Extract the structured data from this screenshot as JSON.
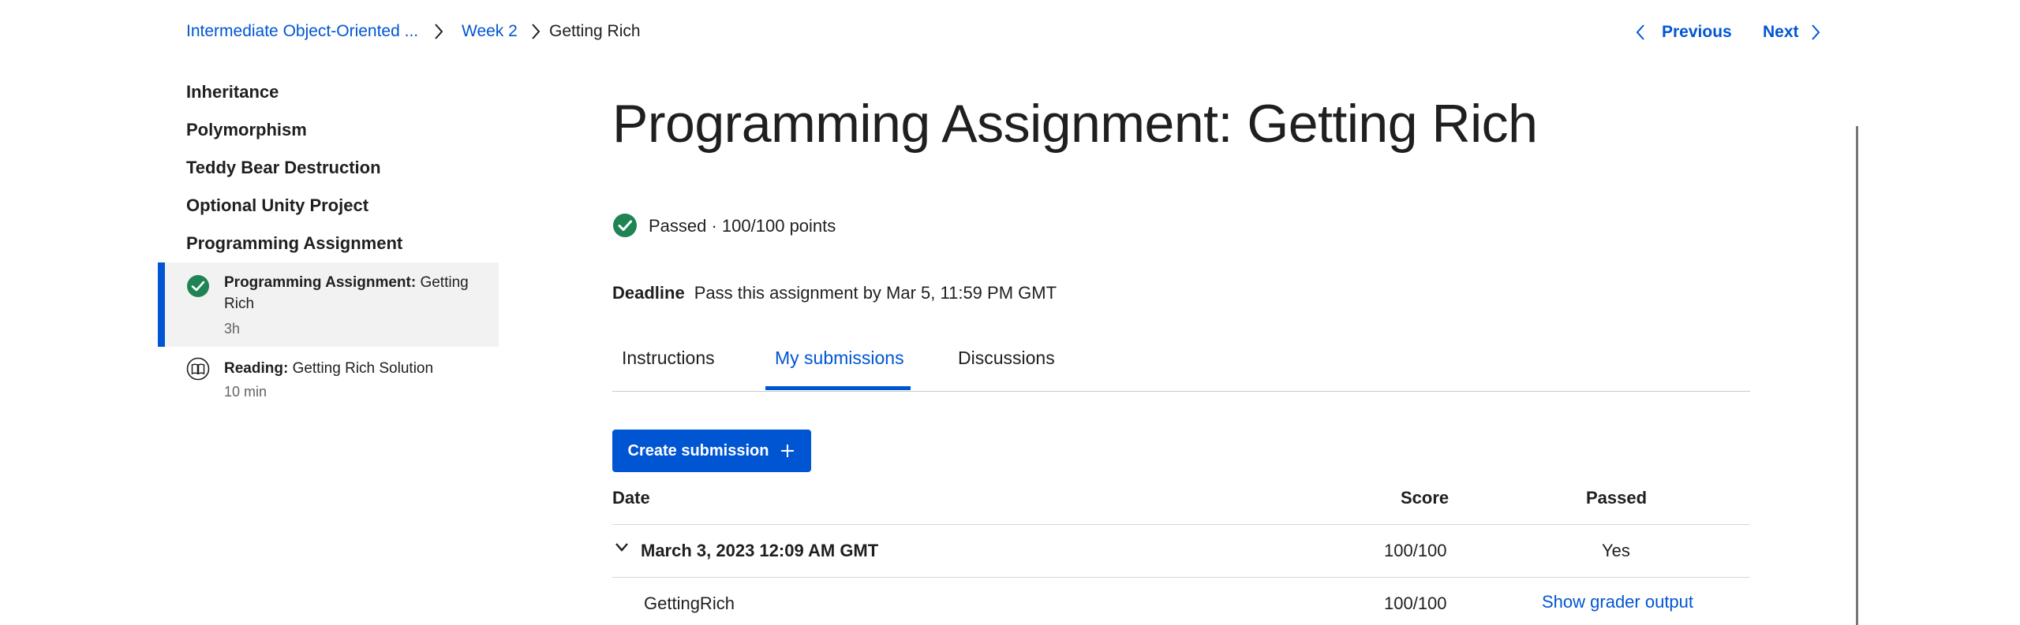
{
  "breadcrumb": {
    "course": "Intermediate Object-Oriented ...",
    "week": "Week 2",
    "current": "Getting Rich"
  },
  "nav": {
    "previous": "Previous",
    "next": "Next"
  },
  "sidebar": {
    "sections": [
      "Inheritance",
      "Polymorphism",
      "Teddy Bear Destruction",
      "Optional Unity Project",
      "Programming Assignment"
    ],
    "items": [
      {
        "type": "Programming Assignment:",
        "title": "Getting Rich",
        "meta": "3h",
        "icon": "check-circle-icon",
        "active": true
      },
      {
        "type": "Reading:",
        "title": "Getting Rich Solution",
        "meta": "10 min",
        "icon": "book-icon",
        "active": false
      }
    ]
  },
  "main": {
    "title": "Programming Assignment: Getting Rich",
    "status": "Passed · 100/100 points",
    "deadline_label": "Deadline",
    "deadline_text": "Pass this assignment by Mar 5, 11:59 PM GMT",
    "tabs": [
      {
        "label": "Instructions",
        "active": false
      },
      {
        "label": "My submissions",
        "active": true
      },
      {
        "label": "Discussions",
        "active": false
      }
    ],
    "create_button": "Create submission",
    "table": {
      "headers": {
        "date": "Date",
        "score": "Score",
        "passed": "Passed"
      },
      "submission": {
        "date": "March 3, 2023 12:09 AM GMT",
        "score": "100/100",
        "passed": "Yes"
      },
      "part": {
        "name": "GettingRich",
        "score": "100/100",
        "action": "Show grader output"
      }
    }
  },
  "colors": {
    "accent": "#0056d2",
    "success": "#1f8354",
    "text": "#1f1f1f",
    "active_bg": "#f2f2f2"
  }
}
